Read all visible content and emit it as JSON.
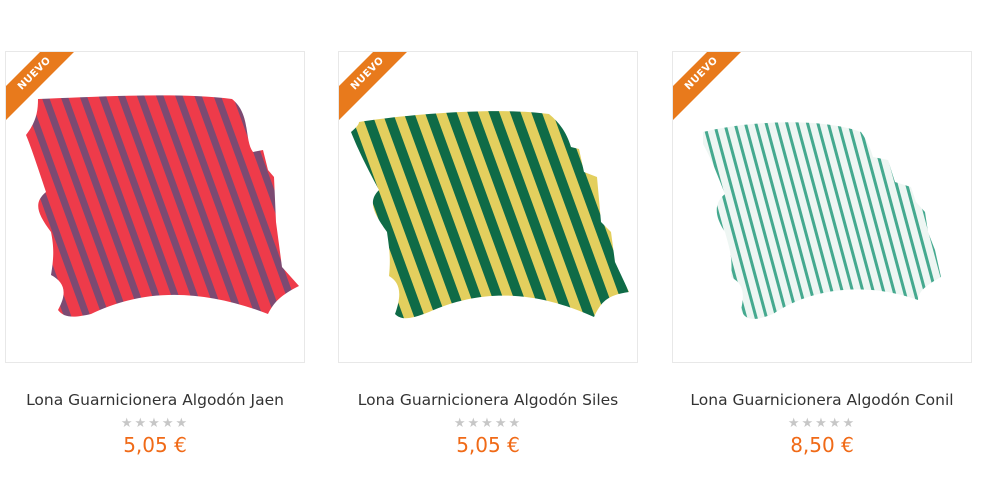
{
  "products": [
    {
      "badge": "NUEVO",
      "name": "Lona Guarnicionera Algodón Jaen",
      "price": "5,05 €",
      "rating_max": 5,
      "rating": 0,
      "colors": {
        "base": "#ee3b4a",
        "stripe": "#7c4a72"
      }
    },
    {
      "badge": "NUEVO",
      "name": "Lona Guarnicionera Algodón Siles",
      "price": "5,05 €",
      "rating_max": 5,
      "rating": 0,
      "colors": {
        "base": "#e3cf5e",
        "stripe": "#0f6b47"
      }
    },
    {
      "badge": "NUEVO",
      "name": "Lona Guarnicionera Algodón Conil",
      "price": "8,50 €",
      "rating_max": 5,
      "rating": 0,
      "colors": {
        "base": "#eef6f3",
        "stripe": "#45a98f"
      }
    }
  ],
  "icons": {
    "star": "star-icon"
  },
  "accent": {
    "badge": "#e87a1c",
    "price": "#f06a17"
  }
}
